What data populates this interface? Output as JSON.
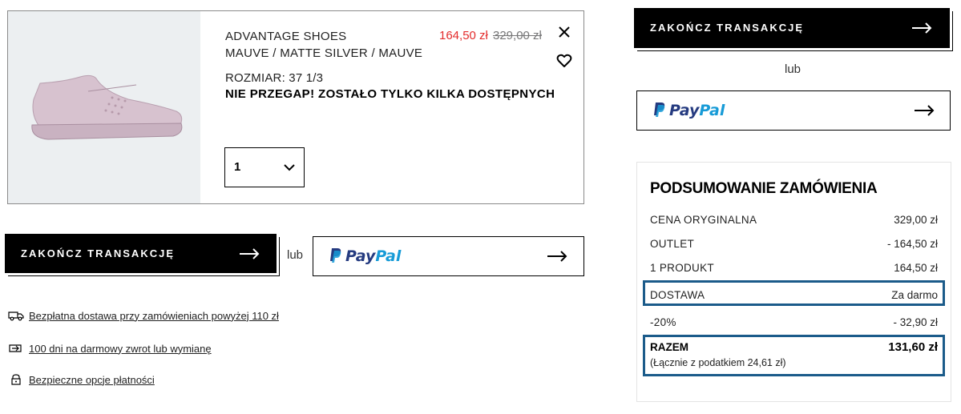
{
  "product": {
    "name": "ADVANTAGE SHOES",
    "color": "MAUVE / MATTE SILVER / MAUVE",
    "size": "ROZMIAR: 37 1/3",
    "stock_warning": "NIE PRZEGAP! ZOSTAŁO TYLKO KILKA DOSTĘPNYCH",
    "price": "164,50 zł",
    "original_price": "329,00 zł",
    "quantity": "1",
    "image": "mauve-sneaker-image"
  },
  "actions": {
    "checkout_label": "ZAKOŃCZ TRANSAKCJĘ",
    "or_label": "lub",
    "paypal_pay": "Pay",
    "paypal_pal": "Pal"
  },
  "benefits": [
    {
      "icon": "delivery-truck-icon",
      "text": "Bezpłatna dostawa przy zamówieniach powyżej 110 zł"
    },
    {
      "icon": "return-icon",
      "text": "100 dni na darmowy zwrot lub wymianę"
    },
    {
      "icon": "lock-icon",
      "text": "Bezpieczne opcje płatności"
    }
  ],
  "summary": {
    "title": "PODSUMOWANIE ZAMÓWIENIA",
    "rows": [
      {
        "label": "CENA ORYGINALNA",
        "value": "329,00 zł"
      },
      {
        "label": "OUTLET",
        "value": "- 164,50 zł"
      },
      {
        "label": "1 PRODUKT",
        "value": "164,50 zł"
      },
      {
        "label": "DOSTAWA",
        "value": "Za darmo"
      },
      {
        "label": "-20%",
        "value": "- 32,90 zł"
      }
    ],
    "total_label": "RAZEM",
    "total_value": "131,60 zł",
    "tax_note": "(Łącznie z podatkiem  24,61 zł)"
  },
  "colors": {
    "sale_red": "#e32b2b",
    "highlight_blue": "#1b5b8a",
    "paypal_dark": "#253b80",
    "paypal_light": "#179bd7"
  }
}
